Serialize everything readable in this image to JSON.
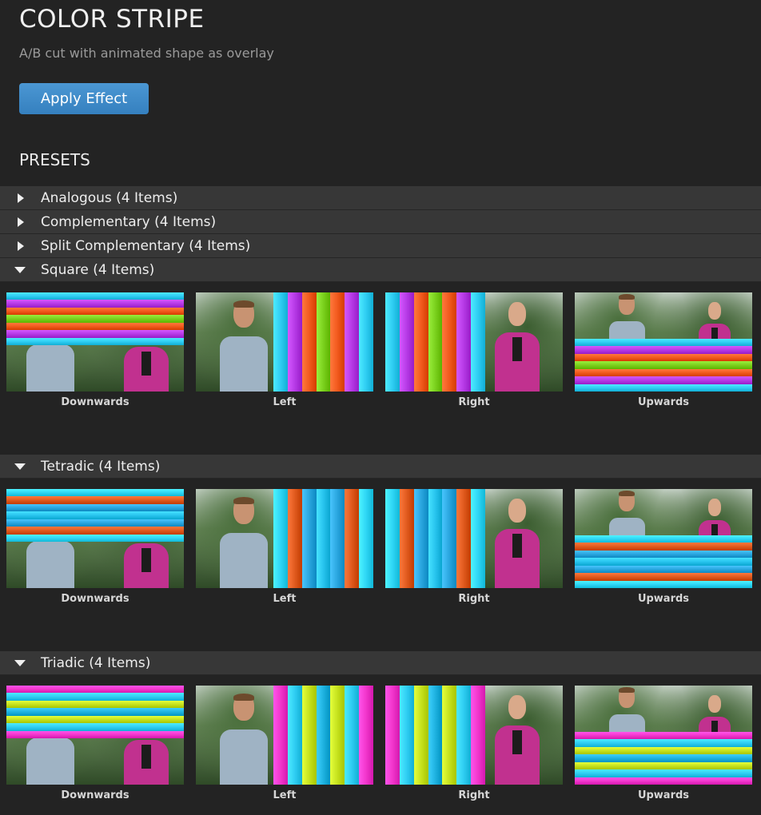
{
  "header": {
    "title": "COLOR STRIPE",
    "subtitle": "A/B cut with animated shape as overlay",
    "apply_label": "Apply Effect"
  },
  "presets_heading": "PRESETS",
  "groups": [
    {
      "label": "Analogous (4 Items)",
      "expanded": false
    },
    {
      "label": "Complementary (4 Items)",
      "expanded": false
    },
    {
      "label": "Split Complementary (4 Items)",
      "expanded": false
    },
    {
      "label": "Square (4 Items)",
      "expanded": true,
      "colors": [
        "#2fcdf2",
        "#b63ae6",
        "#f25a1e",
        "#7bd11e"
      ],
      "items": [
        "Downwards",
        "Left",
        "Right",
        "Upwards"
      ]
    },
    {
      "label": "Tetradic (4 Items)",
      "expanded": true,
      "colors": [
        "#2fd6f5",
        "#e05a1e",
        "#2aa6df",
        "#28c4ee"
      ],
      "items": [
        "Downwards",
        "Left",
        "Right",
        "Upwards"
      ]
    },
    {
      "label": "Triadic (4 Items)",
      "expanded": true,
      "colors": [
        "#f236cc",
        "#2fcdf2",
        "#c6e21e",
        "#1fb2e0"
      ],
      "items": [
        "Downwards",
        "Left",
        "Right",
        "Upwards"
      ]
    }
  ],
  "icons": {
    "collapsed": "triangle-right-icon",
    "expanded": "triangle-down-icon"
  },
  "accent_color": "#3b8ccb"
}
